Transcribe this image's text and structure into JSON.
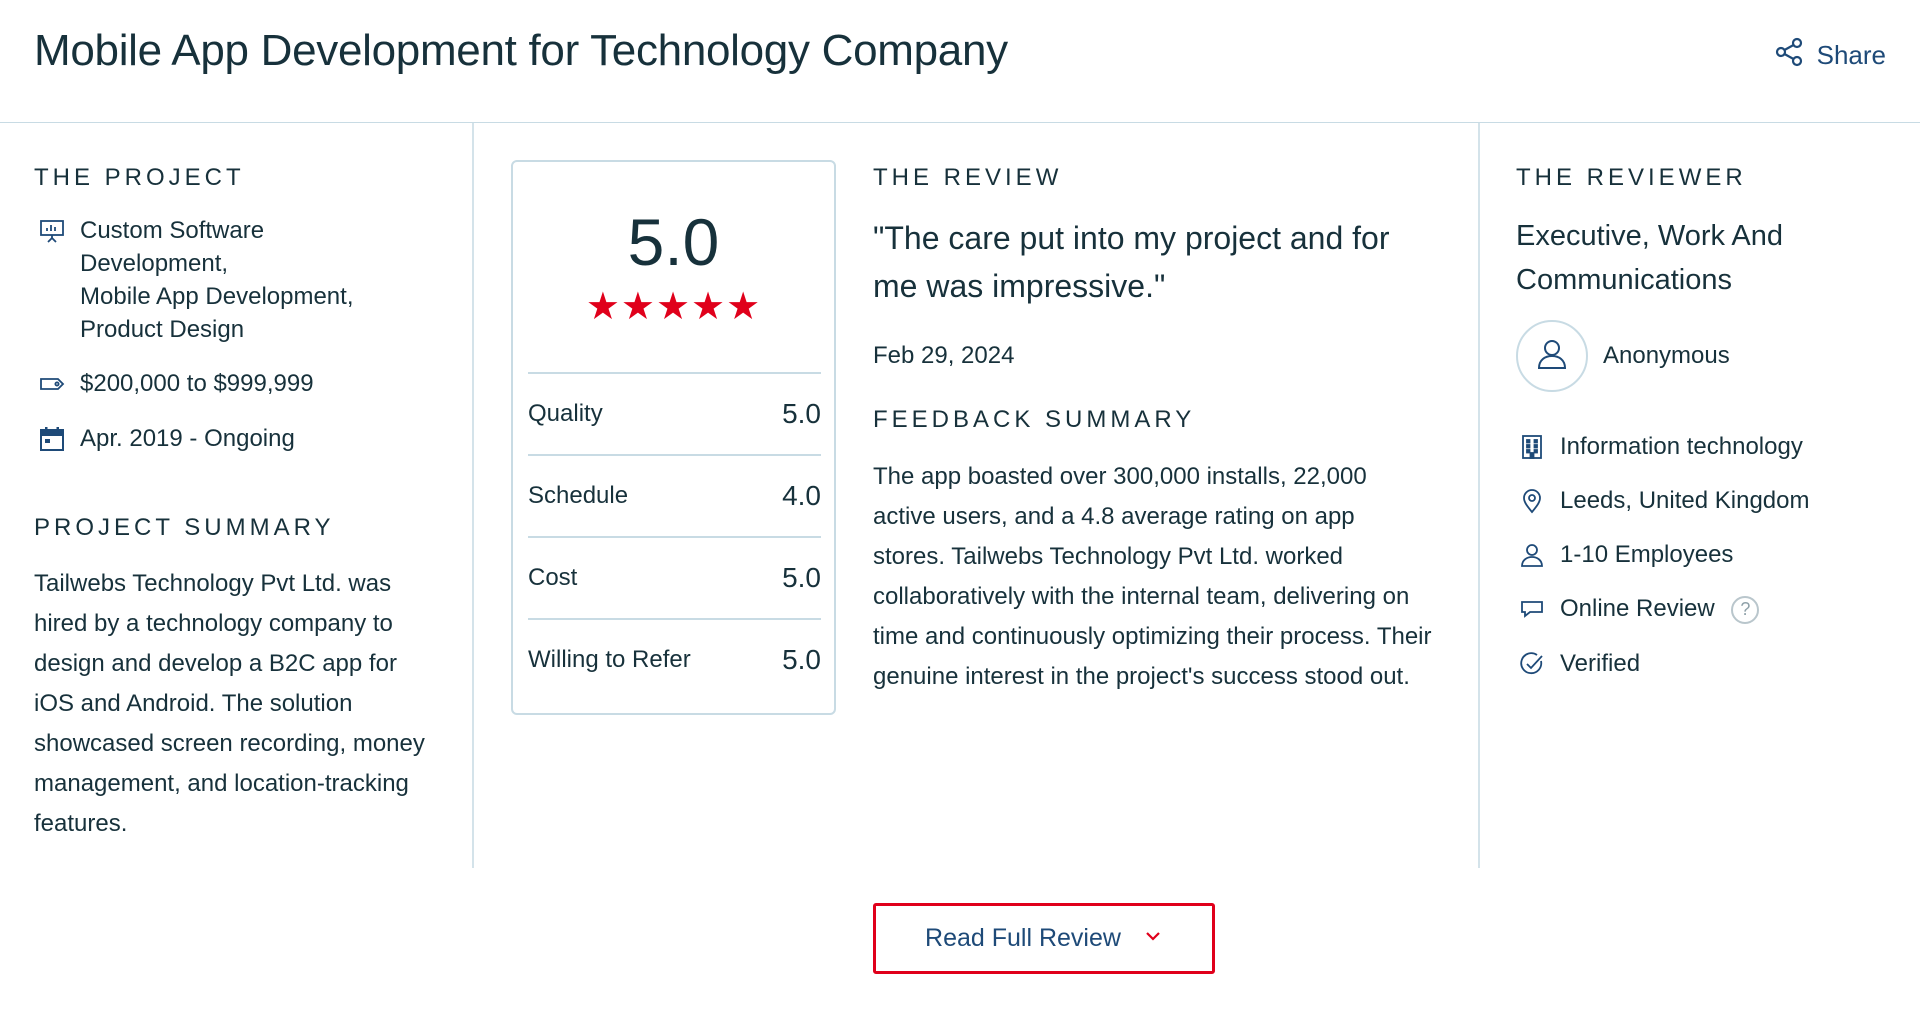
{
  "header": {
    "title": "Mobile App Development for Technology Company",
    "share_label": "Share"
  },
  "project": {
    "heading": "THE PROJECT",
    "services": [
      "Custom Software",
      "Development,",
      "Mobile App Development,",
      "Product Design"
    ],
    "budget": "$200,000 to $999,999",
    "timeline": "Apr. 2019 - Ongoing",
    "summary_heading": "PROJECT SUMMARY",
    "summary": "Tailwebs Technology Pvt Ltd. was hired by a technology company to design and develop a B2C app for iOS and Android. The solution showcased screen recording, money management, and location-tracking features."
  },
  "rating": {
    "overall": "5.0",
    "stars": "★★★★★",
    "star_count": 5,
    "star_color": "#e0001b",
    "rows": [
      {
        "label": "Quality",
        "value": "5.0"
      },
      {
        "label": "Schedule",
        "value": "4.0"
      },
      {
        "label": "Cost",
        "value": "5.0"
      },
      {
        "label": "Willing to Refer",
        "value": "5.0"
      }
    ]
  },
  "review": {
    "heading": "THE REVIEW",
    "quote": "\"The care put into my project and for me was impressive.\"",
    "date": "Feb 29, 2024",
    "feedback_heading": "FEEDBACK SUMMARY",
    "feedback": "The app boasted over 300,000 installs, 22,000 active users, and a 4.8 average rating on app stores. Tailwebs Technology Pvt Ltd. worked collaboratively with the internal team, delivering on time and continuously optimizing their process. Their genuine interest in the project's success stood out."
  },
  "reviewer": {
    "heading": "THE REVIEWER",
    "title": "Executive, Work And Communications",
    "name": "Anonymous",
    "industry": "Information technology",
    "location": "Leeds, United Kingdom",
    "size": "1-10 Employees",
    "review_type": "Online Review",
    "help_glyph": "?",
    "verified": "Verified"
  },
  "actions": {
    "read_full_review": "Read Full Review"
  },
  "colors": {
    "accent_red": "#e0001b",
    "link_blue": "#1e4a78",
    "text": "#17313b",
    "divider": "#c8dbe4"
  }
}
